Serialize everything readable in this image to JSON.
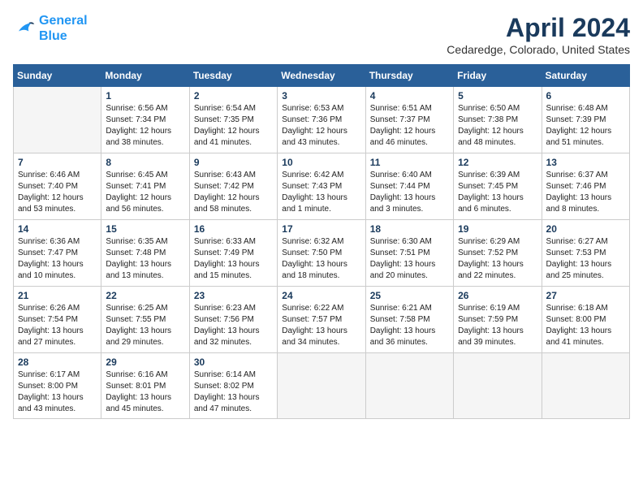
{
  "header": {
    "logo_line1": "General",
    "logo_line2": "Blue",
    "title": "April 2024",
    "location": "Cedaredge, Colorado, United States"
  },
  "days_of_week": [
    "Sunday",
    "Monday",
    "Tuesday",
    "Wednesday",
    "Thursday",
    "Friday",
    "Saturday"
  ],
  "weeks": [
    [
      {
        "day": "",
        "empty": true
      },
      {
        "day": "1",
        "sunrise": "Sunrise: 6:56 AM",
        "sunset": "Sunset: 7:34 PM",
        "daylight": "Daylight: 12 hours and 38 minutes."
      },
      {
        "day": "2",
        "sunrise": "Sunrise: 6:54 AM",
        "sunset": "Sunset: 7:35 PM",
        "daylight": "Daylight: 12 hours and 41 minutes."
      },
      {
        "day": "3",
        "sunrise": "Sunrise: 6:53 AM",
        "sunset": "Sunset: 7:36 PM",
        "daylight": "Daylight: 12 hours and 43 minutes."
      },
      {
        "day": "4",
        "sunrise": "Sunrise: 6:51 AM",
        "sunset": "Sunset: 7:37 PM",
        "daylight": "Daylight: 12 hours and 46 minutes."
      },
      {
        "day": "5",
        "sunrise": "Sunrise: 6:50 AM",
        "sunset": "Sunset: 7:38 PM",
        "daylight": "Daylight: 12 hours and 48 minutes."
      },
      {
        "day": "6",
        "sunrise": "Sunrise: 6:48 AM",
        "sunset": "Sunset: 7:39 PM",
        "daylight": "Daylight: 12 hours and 51 minutes."
      }
    ],
    [
      {
        "day": "7",
        "sunrise": "Sunrise: 6:46 AM",
        "sunset": "Sunset: 7:40 PM",
        "daylight": "Daylight: 12 hours and 53 minutes."
      },
      {
        "day": "8",
        "sunrise": "Sunrise: 6:45 AM",
        "sunset": "Sunset: 7:41 PM",
        "daylight": "Daylight: 12 hours and 56 minutes."
      },
      {
        "day": "9",
        "sunrise": "Sunrise: 6:43 AM",
        "sunset": "Sunset: 7:42 PM",
        "daylight": "Daylight: 12 hours and 58 minutes."
      },
      {
        "day": "10",
        "sunrise": "Sunrise: 6:42 AM",
        "sunset": "Sunset: 7:43 PM",
        "daylight": "Daylight: 13 hours and 1 minute."
      },
      {
        "day": "11",
        "sunrise": "Sunrise: 6:40 AM",
        "sunset": "Sunset: 7:44 PM",
        "daylight": "Daylight: 13 hours and 3 minutes."
      },
      {
        "day": "12",
        "sunrise": "Sunrise: 6:39 AM",
        "sunset": "Sunset: 7:45 PM",
        "daylight": "Daylight: 13 hours and 6 minutes."
      },
      {
        "day": "13",
        "sunrise": "Sunrise: 6:37 AM",
        "sunset": "Sunset: 7:46 PM",
        "daylight": "Daylight: 13 hours and 8 minutes."
      }
    ],
    [
      {
        "day": "14",
        "sunrise": "Sunrise: 6:36 AM",
        "sunset": "Sunset: 7:47 PM",
        "daylight": "Daylight: 13 hours and 10 minutes."
      },
      {
        "day": "15",
        "sunrise": "Sunrise: 6:35 AM",
        "sunset": "Sunset: 7:48 PM",
        "daylight": "Daylight: 13 hours and 13 minutes."
      },
      {
        "day": "16",
        "sunrise": "Sunrise: 6:33 AM",
        "sunset": "Sunset: 7:49 PM",
        "daylight": "Daylight: 13 hours and 15 minutes."
      },
      {
        "day": "17",
        "sunrise": "Sunrise: 6:32 AM",
        "sunset": "Sunset: 7:50 PM",
        "daylight": "Daylight: 13 hours and 18 minutes."
      },
      {
        "day": "18",
        "sunrise": "Sunrise: 6:30 AM",
        "sunset": "Sunset: 7:51 PM",
        "daylight": "Daylight: 13 hours and 20 minutes."
      },
      {
        "day": "19",
        "sunrise": "Sunrise: 6:29 AM",
        "sunset": "Sunset: 7:52 PM",
        "daylight": "Daylight: 13 hours and 22 minutes."
      },
      {
        "day": "20",
        "sunrise": "Sunrise: 6:27 AM",
        "sunset": "Sunset: 7:53 PM",
        "daylight": "Daylight: 13 hours and 25 minutes."
      }
    ],
    [
      {
        "day": "21",
        "sunrise": "Sunrise: 6:26 AM",
        "sunset": "Sunset: 7:54 PM",
        "daylight": "Daylight: 13 hours and 27 minutes."
      },
      {
        "day": "22",
        "sunrise": "Sunrise: 6:25 AM",
        "sunset": "Sunset: 7:55 PM",
        "daylight": "Daylight: 13 hours and 29 minutes."
      },
      {
        "day": "23",
        "sunrise": "Sunrise: 6:23 AM",
        "sunset": "Sunset: 7:56 PM",
        "daylight": "Daylight: 13 hours and 32 minutes."
      },
      {
        "day": "24",
        "sunrise": "Sunrise: 6:22 AM",
        "sunset": "Sunset: 7:57 PM",
        "daylight": "Daylight: 13 hours and 34 minutes."
      },
      {
        "day": "25",
        "sunrise": "Sunrise: 6:21 AM",
        "sunset": "Sunset: 7:58 PM",
        "daylight": "Daylight: 13 hours and 36 minutes."
      },
      {
        "day": "26",
        "sunrise": "Sunrise: 6:19 AM",
        "sunset": "Sunset: 7:59 PM",
        "daylight": "Daylight: 13 hours and 39 minutes."
      },
      {
        "day": "27",
        "sunrise": "Sunrise: 6:18 AM",
        "sunset": "Sunset: 8:00 PM",
        "daylight": "Daylight: 13 hours and 41 minutes."
      }
    ],
    [
      {
        "day": "28",
        "sunrise": "Sunrise: 6:17 AM",
        "sunset": "Sunset: 8:00 PM",
        "daylight": "Daylight: 13 hours and 43 minutes."
      },
      {
        "day": "29",
        "sunrise": "Sunrise: 6:16 AM",
        "sunset": "Sunset: 8:01 PM",
        "daylight": "Daylight: 13 hours and 45 minutes."
      },
      {
        "day": "30",
        "sunrise": "Sunrise: 6:14 AM",
        "sunset": "Sunset: 8:02 PM",
        "daylight": "Daylight: 13 hours and 47 minutes."
      },
      {
        "day": "",
        "empty": true
      },
      {
        "day": "",
        "empty": true
      },
      {
        "day": "",
        "empty": true
      },
      {
        "day": "",
        "empty": true
      }
    ]
  ]
}
